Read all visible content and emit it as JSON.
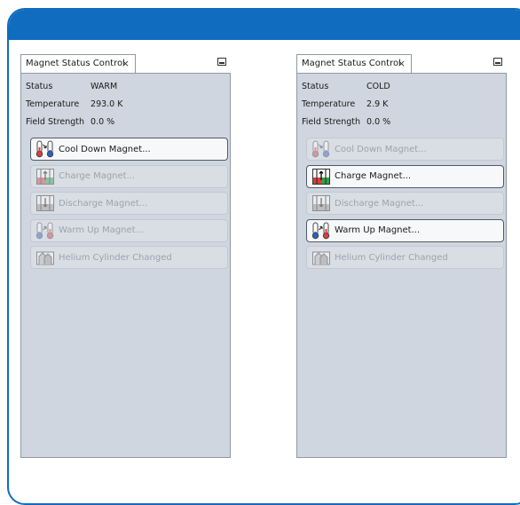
{
  "panels": [
    {
      "tab_title": "Magnet Status Control",
      "close_glyph": "×",
      "status_label": "Status",
      "status_value": "WARM",
      "temperature_label": "Temperature",
      "temperature_value": "293.0  K",
      "field_label": "Field Strength",
      "field_value": "0.0  %",
      "buttons": [
        {
          "label": "Cool Down Magnet...",
          "enabled": true,
          "icon": "cool-down-icon"
        },
        {
          "label": "Charge Magnet...",
          "enabled": false,
          "icon": "charge-icon"
        },
        {
          "label": "Discharge Magnet...",
          "enabled": false,
          "icon": "discharge-icon"
        },
        {
          "label": "Warm Up Magnet...",
          "enabled": false,
          "icon": "warm-up-icon"
        },
        {
          "label": "Helium Cylinder Changed",
          "enabled": false,
          "icon": "helium-cylinder-icon"
        }
      ]
    },
    {
      "tab_title": "Magnet Status Control",
      "close_glyph": "×",
      "status_label": "Status",
      "status_value": "COLD",
      "temperature_label": "Temperature",
      "temperature_value": "2.9  K",
      "field_label": "Field Strength",
      "field_value": "0.0  %",
      "buttons": [
        {
          "label": "Cool Down Magnet...",
          "enabled": false,
          "icon": "cool-down-icon"
        },
        {
          "label": "Charge Magnet...",
          "enabled": true,
          "icon": "charge-icon"
        },
        {
          "label": "Discharge Magnet...",
          "enabled": false,
          "icon": "discharge-icon"
        },
        {
          "label": "Warm Up Magnet...",
          "enabled": true,
          "icon": "warm-up-icon"
        },
        {
          "label": "Helium Cylinder Changed",
          "enabled": false,
          "icon": "helium-cylinder-icon"
        }
      ]
    }
  ],
  "colors": {
    "header": "#0f6cbf",
    "panel_bg": "#cfd6df",
    "thermo_red": "#e03c3c",
    "thermo_blue": "#2c5fc9",
    "charge_red": "#e03c3c",
    "charge_green": "#2ea34a"
  }
}
